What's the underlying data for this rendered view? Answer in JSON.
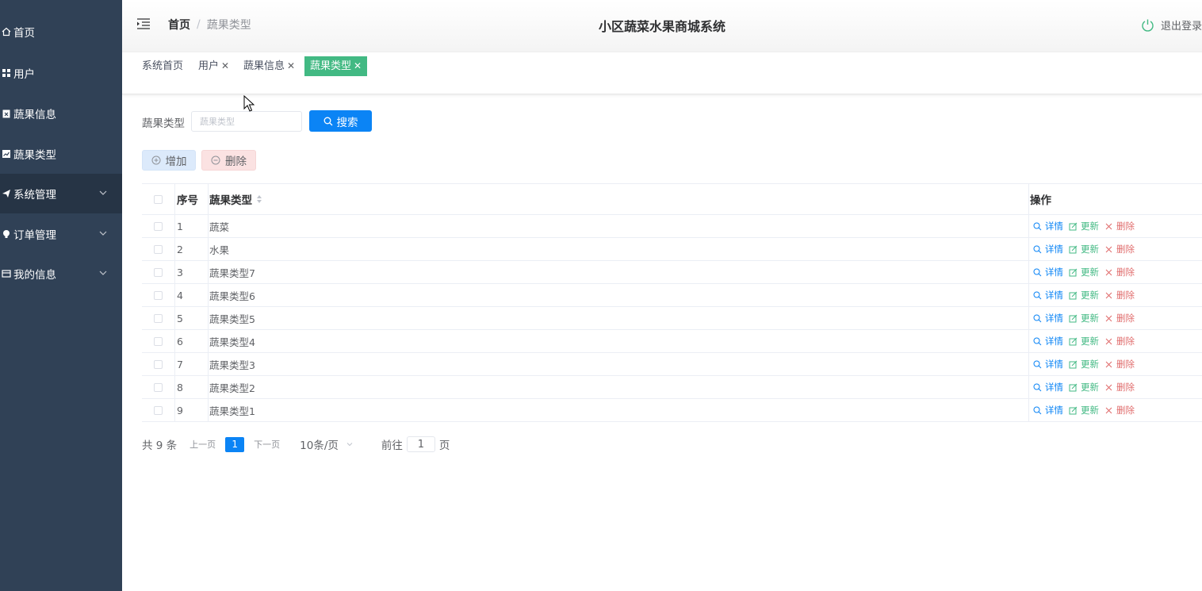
{
  "sidebar": {
    "items": [
      {
        "label": "首页",
        "icon": "home-icon"
      },
      {
        "label": "用户",
        "icon": "grid-icon"
      },
      {
        "label": "蔬果信息",
        "icon": "clipboard-icon"
      },
      {
        "label": "蔬果类型",
        "icon": "chart-icon"
      },
      {
        "label": "系统管理",
        "icon": "send-icon"
      },
      {
        "label": "订单管理",
        "icon": "bulb-icon"
      },
      {
        "label": "我的信息",
        "icon": "card-icon"
      }
    ]
  },
  "header": {
    "breadcrumb_home": "首页",
    "breadcrumb_separator": "/",
    "breadcrumb_current": "蔬果类型",
    "title": "小区蔬菜水果商城系统",
    "logout_label": "退出登录"
  },
  "tags": [
    {
      "label": "系统首页",
      "closable": false
    },
    {
      "label": "用户",
      "closable": true
    },
    {
      "label": "蔬果信息",
      "closable": true
    },
    {
      "label": "蔬果类型",
      "closable": true
    }
  ],
  "tag_close": "✕",
  "search": {
    "label": "蔬果类型",
    "placeholder": "蔬果类型",
    "button_label": "搜索"
  },
  "actions": {
    "add_label": "增加",
    "delete_label": "删除"
  },
  "table": {
    "columns": {
      "index": "序号",
      "name": "蔬果类型",
      "ops": "操作"
    },
    "ops": {
      "detail": "详情",
      "update": "更新",
      "delete": "删除"
    },
    "rows": [
      {
        "index": "1",
        "name": "蔬菜"
      },
      {
        "index": "2",
        "name": "水果"
      },
      {
        "index": "3",
        "name": "蔬果类型7"
      },
      {
        "index": "4",
        "name": "蔬果类型6"
      },
      {
        "index": "5",
        "name": "蔬果类型5"
      },
      {
        "index": "6",
        "name": "蔬果类型4"
      },
      {
        "index": "7",
        "name": "蔬果类型3"
      },
      {
        "index": "8",
        "name": "蔬果类型2"
      },
      {
        "index": "9",
        "name": "蔬果类型1"
      }
    ]
  },
  "pagination": {
    "total": "共 9 条",
    "prev": "上一页",
    "page": "1",
    "next": "下一页",
    "page_size": "10条/页",
    "goto_label": "前往",
    "goto_value": "1",
    "page_suffix": "页"
  },
  "colors": {
    "sidebar_bg": "#304156",
    "primary": "#0b84f5",
    "active_tag": "#42b983",
    "danger": "#e06c6c"
  }
}
